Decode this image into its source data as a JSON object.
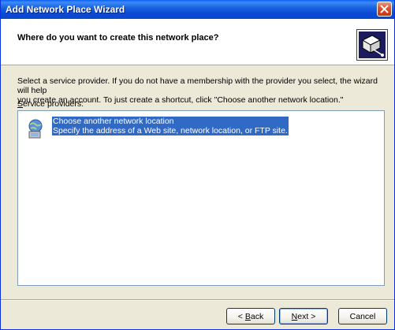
{
  "window": {
    "title": "Add Network Place Wizard"
  },
  "header": {
    "title": "Where do you want to create this network place?",
    "icon": "network-folder-icon"
  },
  "body": {
    "description_line1": "Select a service provider.  If you do not have a membership with the provider you select, the wizard will help",
    "description_line2": "you create an account.  To just create a shortcut, click \"Choose another network location.\"",
    "providers_label_first": "S",
    "providers_label_rest": "ervice providers:"
  },
  "providers": [
    {
      "name": "Choose another network location",
      "detail": "Specify the address of a Web site, network location, or FTP site.",
      "icon": "globe-computer-icon",
      "selected": true
    }
  ],
  "buttons": {
    "back_prefix": "< ",
    "back_accel": "B",
    "back_rest": "ack",
    "next_accel": "N",
    "next_rest": "ext >",
    "cancel": "Cancel"
  },
  "colors": {
    "titlebar": "#0a4ad6",
    "selection": "#316ac5",
    "face": "#ece9d8",
    "close": "#d8512f"
  }
}
